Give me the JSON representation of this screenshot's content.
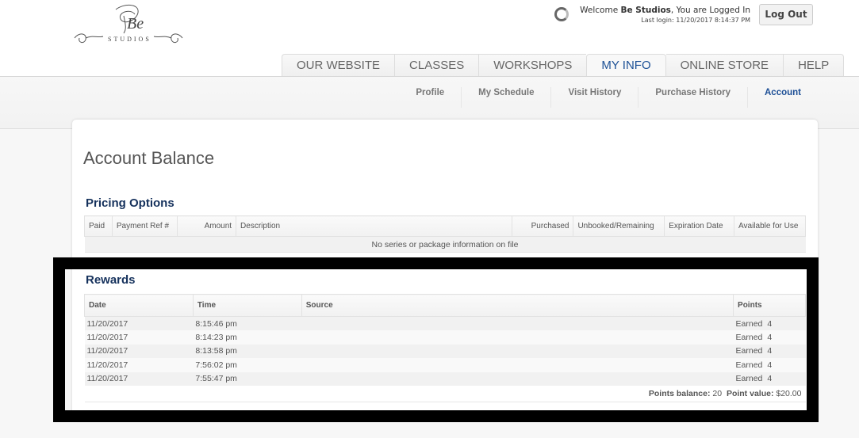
{
  "header": {
    "logo_alt": "Be Studios",
    "welcome_prefix": "Welcome ",
    "welcome_name": "Be Studios",
    "welcome_suffix": ", You are Logged In",
    "last_login": "Last login: 11/20/2017 8:14:37 PM",
    "logout_label": "Log Out"
  },
  "tabs": [
    {
      "label": "OUR WEBSITE",
      "active": false
    },
    {
      "label": "CLASSES",
      "active": false
    },
    {
      "label": "WORKSHOPS",
      "active": false
    },
    {
      "label": "MY INFO",
      "active": true
    },
    {
      "label": "ONLINE STORE",
      "active": false
    },
    {
      "label": "HELP",
      "active": false
    }
  ],
  "subnav": [
    {
      "label": "Profile",
      "active": false
    },
    {
      "label": "My Schedule",
      "active": false
    },
    {
      "label": "Visit History",
      "active": false
    },
    {
      "label": "Purchase History",
      "active": false
    },
    {
      "label": "Account",
      "active": true
    }
  ],
  "page_title": "Account Balance",
  "pricing": {
    "title": "Pricing Options",
    "columns": [
      "Paid",
      "Payment Ref #",
      "Amount",
      "Description",
      "Purchased",
      "Unbooked/Remaining",
      "Expiration Date",
      "Available for Use"
    ],
    "empty_message": "No series or package information on file"
  },
  "rewards": {
    "title": "Rewards",
    "columns": [
      "Date",
      "Time",
      "Source",
      "Points"
    ],
    "rows": [
      {
        "date": "11/20/2017",
        "time": "8:15:46 pm",
        "source": "",
        "points_label": "Earned",
        "points": "4"
      },
      {
        "date": "11/20/2017",
        "time": "8:14:23 pm",
        "source": "",
        "points_label": "Earned",
        "points": "4"
      },
      {
        "date": "11/20/2017",
        "time": "8:13:58 pm",
        "source": "",
        "points_label": "Earned",
        "points": "4"
      },
      {
        "date": "11/20/2017",
        "time": "7:56:02 pm",
        "source": "",
        "points_label": "Earned",
        "points": "4"
      },
      {
        "date": "11/20/2017",
        "time": "7:55:47 pm",
        "source": "",
        "points_label": "Earned",
        "points": "4"
      }
    ],
    "balance_label": "Points balance:",
    "balance_value": "20",
    "value_label": "Point value:",
    "value_value": "$20.00"
  },
  "colors": {
    "accent": "#1d5196",
    "section_title": "#15315c",
    "highlight_frame": "#000000"
  }
}
